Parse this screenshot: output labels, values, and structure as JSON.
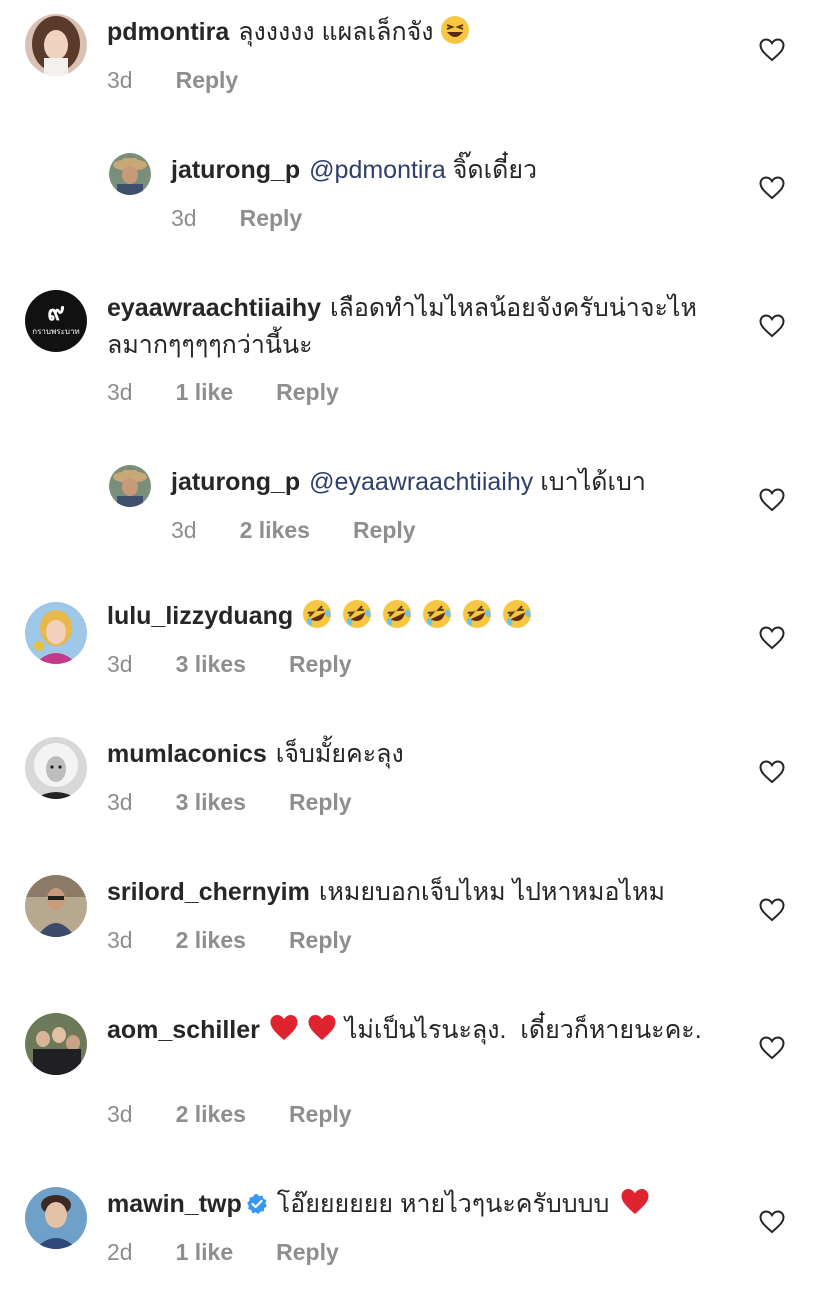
{
  "comments": [
    {
      "username": "pdmontira",
      "mention": "",
      "text": "ลุงงงงง แผลเล็กจัง",
      "emojis": [
        "grinning-squinting"
      ],
      "time": "3d",
      "likes": "",
      "reply_label": "Reply",
      "is_reply": false,
      "avatar": "woman-portrait"
    },
    {
      "username": "jaturong_p",
      "mention": "@pdmontira",
      "text": "จิ๊ดเดี๋ยว",
      "emojis": [],
      "time": "3d",
      "likes": "",
      "reply_label": "Reply",
      "is_reply": true,
      "avatar": "man-cowboy-hat"
    },
    {
      "username": "eyaawraachtiiaihy",
      "mention": "",
      "text": "เลือดทำไมไหลน้อยจังครับน่าจะไหลมากๆๆๆๆกว่านี้นะ",
      "emojis": [],
      "time": "3d",
      "likes": "1 like",
      "reply_label": "Reply",
      "is_reply": false,
      "avatar": "logo-black-circle",
      "avatar_text": "กราบพระบาท"
    },
    {
      "username": "jaturong_p",
      "mention": "@eyaawraachtiiaihy",
      "text": "เบาได้เบา",
      "emojis": [],
      "time": "3d",
      "likes": "2 likes",
      "reply_label": "Reply",
      "is_reply": true,
      "avatar": "man-cowboy-hat"
    },
    {
      "username": "lulu_lizzyduang",
      "mention": "",
      "text": "",
      "emojis": [
        "rolling-on-floor-laughing",
        "rolling-on-floor-laughing",
        "rolling-on-floor-laughing",
        "rolling-on-floor-laughing",
        "rolling-on-floor-laughing",
        "rolling-on-floor-laughing"
      ],
      "time": "3d",
      "likes": "3 likes",
      "reply_label": "Reply",
      "is_reply": false,
      "avatar": "woman-colorful"
    },
    {
      "username": "mumlaconics",
      "mention": "",
      "text": "เจ็บมั้ยคะลุง",
      "emojis": [],
      "time": "3d",
      "likes": "3 likes",
      "reply_label": "Reply",
      "is_reply": false,
      "avatar": "blonde-bw-portrait"
    },
    {
      "username": "srilord_chernyim",
      "mention": "",
      "text": "เหมยบอกเจ็บไหม ไปหาหมอไหม",
      "emojis": [],
      "time": "3d",
      "likes": "2 likes",
      "reply_label": "Reply",
      "is_reply": false,
      "avatar": "man-glasses"
    },
    {
      "username": "aom_schiller",
      "mention": "",
      "text": "ไม่เป็นไรนะลุง.  เดี๋ยวก็หายนะคะ.",
      "emojis_before": [
        "red-heart",
        "red-heart"
      ],
      "emojis": [],
      "time": "3d",
      "likes": "2 likes",
      "reply_label": "Reply",
      "is_reply": false,
      "avatar": "group-photo"
    },
    {
      "username": "mawin_twp",
      "verified": true,
      "mention": "",
      "text": "โอ๊ยยยยยย หายไวๆนะครับบบบ",
      "emojis": [
        "red-heart"
      ],
      "time": "2d",
      "likes": "1 like",
      "reply_label": "Reply",
      "is_reply": false,
      "avatar": "man-portrait"
    }
  ],
  "icons": {
    "like": "heart-outline-icon",
    "verified": "verified-badge-icon"
  },
  "colors": {
    "text": "#262626",
    "meta": "#8e8e8e",
    "mention": "#2f3f6b",
    "verified": "#3897f0",
    "heart_emoji": "#e0242f"
  }
}
